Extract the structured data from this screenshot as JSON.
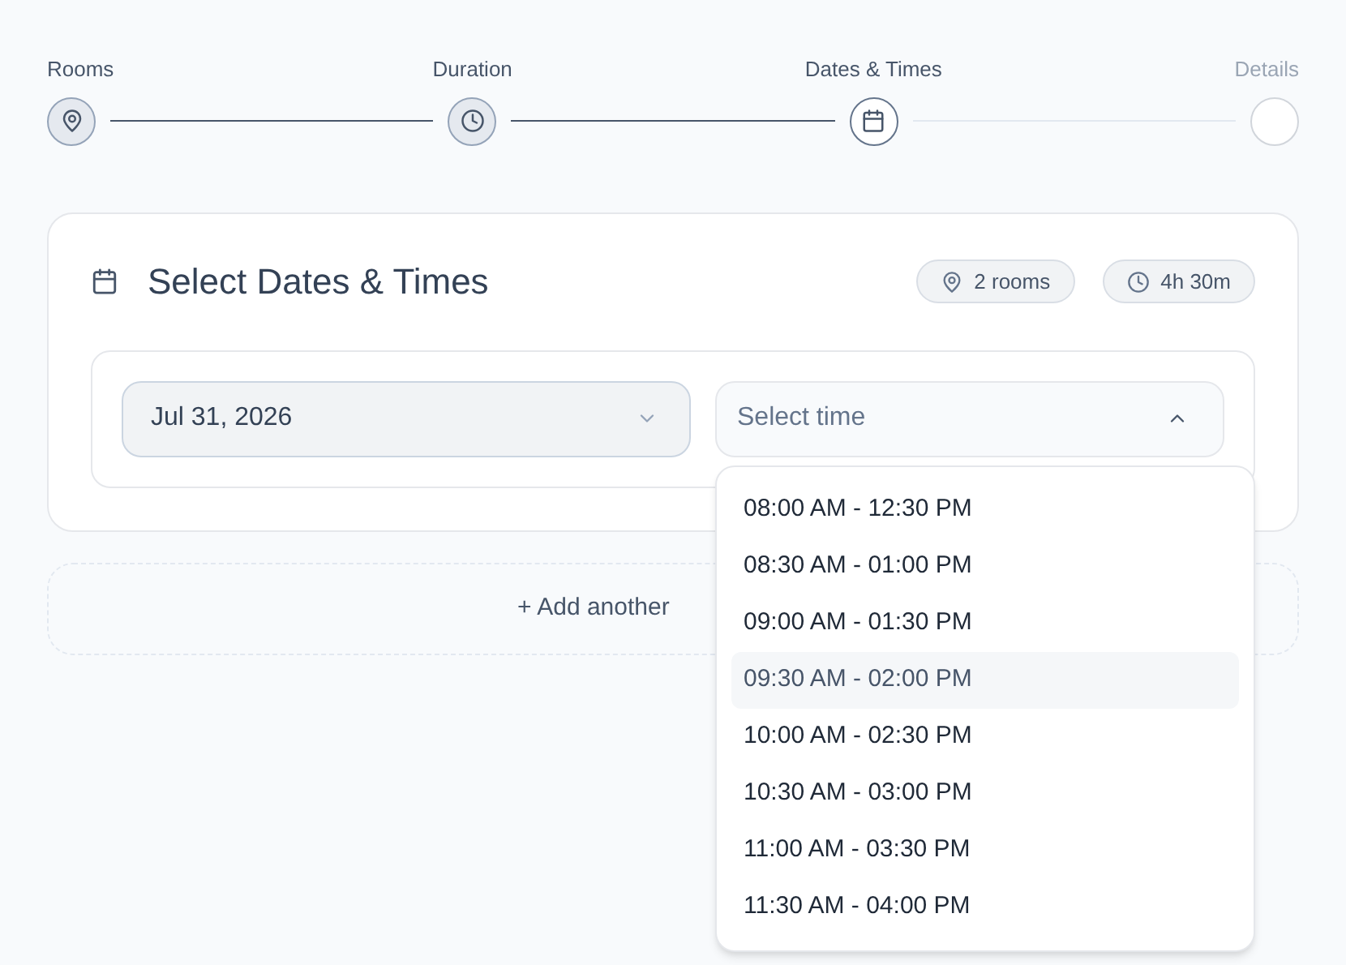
{
  "steps": [
    {
      "label": "Rooms",
      "completed": true,
      "selected": false
    },
    {
      "label": "Duration",
      "completed": true,
      "selected": false
    },
    {
      "label": "Dates & Times",
      "completed": false,
      "selected": true
    },
    {
      "label": "Details",
      "completed": false,
      "selected": false
    }
  ],
  "card": {
    "title": "Select Dates & Times",
    "chips": [
      {
        "label": "2 rooms"
      },
      {
        "label": "4h 30m"
      }
    ]
  },
  "date_select": {
    "value": "Jul 31, 2026",
    "expanded": false
  },
  "time_select": {
    "placeholder": "Select time",
    "expanded": true
  },
  "time_options": [
    {
      "label": "08:00 AM - 12:30 PM",
      "highlighted": false
    },
    {
      "label": "08:30 AM - 01:00 PM",
      "highlighted": false
    },
    {
      "label": "09:00 AM - 01:30 PM",
      "highlighted": false
    },
    {
      "label": "09:30 AM - 02:00 PM",
      "highlighted": true
    },
    {
      "label": "10:00 AM - 02:30 PM",
      "highlighted": false
    },
    {
      "label": "10:30 AM - 03:00 PM",
      "highlighted": false
    },
    {
      "label": "11:00 AM - 03:30 PM",
      "highlighted": false
    },
    {
      "label": "11:30 AM - 04:00 PM",
      "highlighted": false
    }
  ],
  "add_button": {
    "label": "+ Add another"
  }
}
